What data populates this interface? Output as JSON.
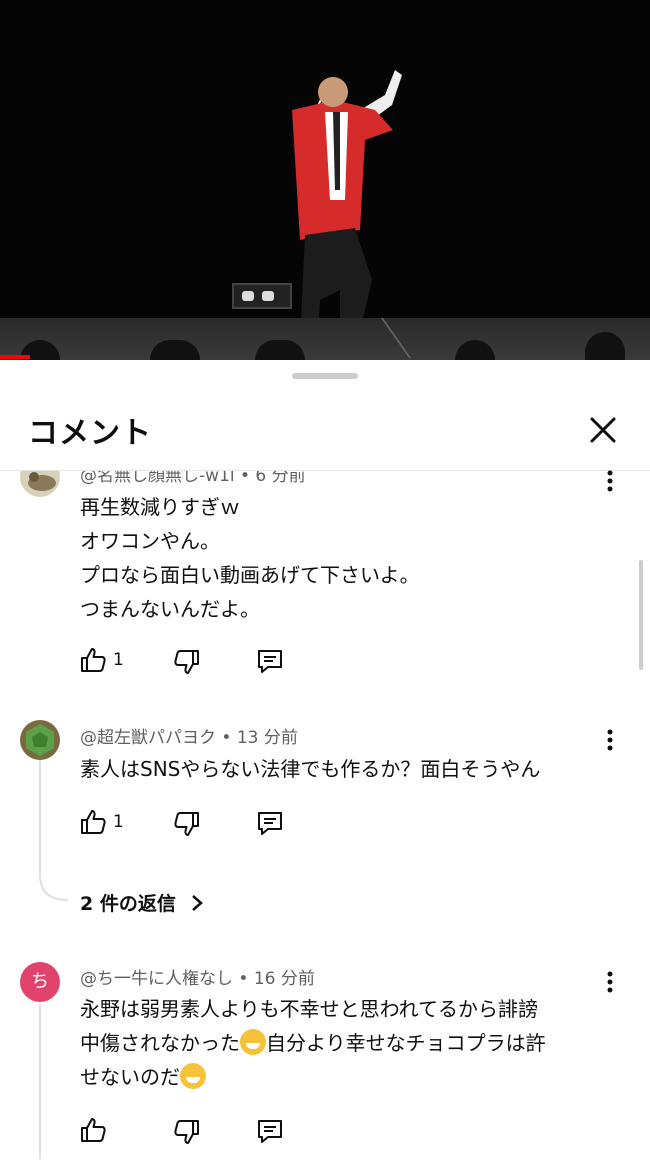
{
  "header": {
    "title": "コメント"
  },
  "comments": [
    {
      "author_meta": "@名無し顔無し-w1l • 6 分前",
      "lines": [
        "再生数減りすぎｗ",
        "オワコンやん。",
        "プロなら面白い動画あげて下さいよ。",
        "つまんないんだよ。"
      ],
      "likes": "1"
    },
    {
      "author_meta": "@超左獣パパヨク • 13 分前",
      "lines": [
        "素人はSNSやらない法律でも作るか？面白そうやん"
      ],
      "likes": "1",
      "replies_label": "2 件の返信"
    },
    {
      "avatar_letter": "ち",
      "author_meta": "@ち一牛に人権なし • 16 分前",
      "line1": "永野は弱男素人よりも不幸せと思われてるから誹謗",
      "line2a": "中傷されなかった",
      "line2b": "自分より幸せなチョコプラは許",
      "line3": "せないのだ",
      "likes": ""
    }
  ],
  "colors": {
    "accent": "#ff0000",
    "avatar_pink": "#e0446c"
  }
}
